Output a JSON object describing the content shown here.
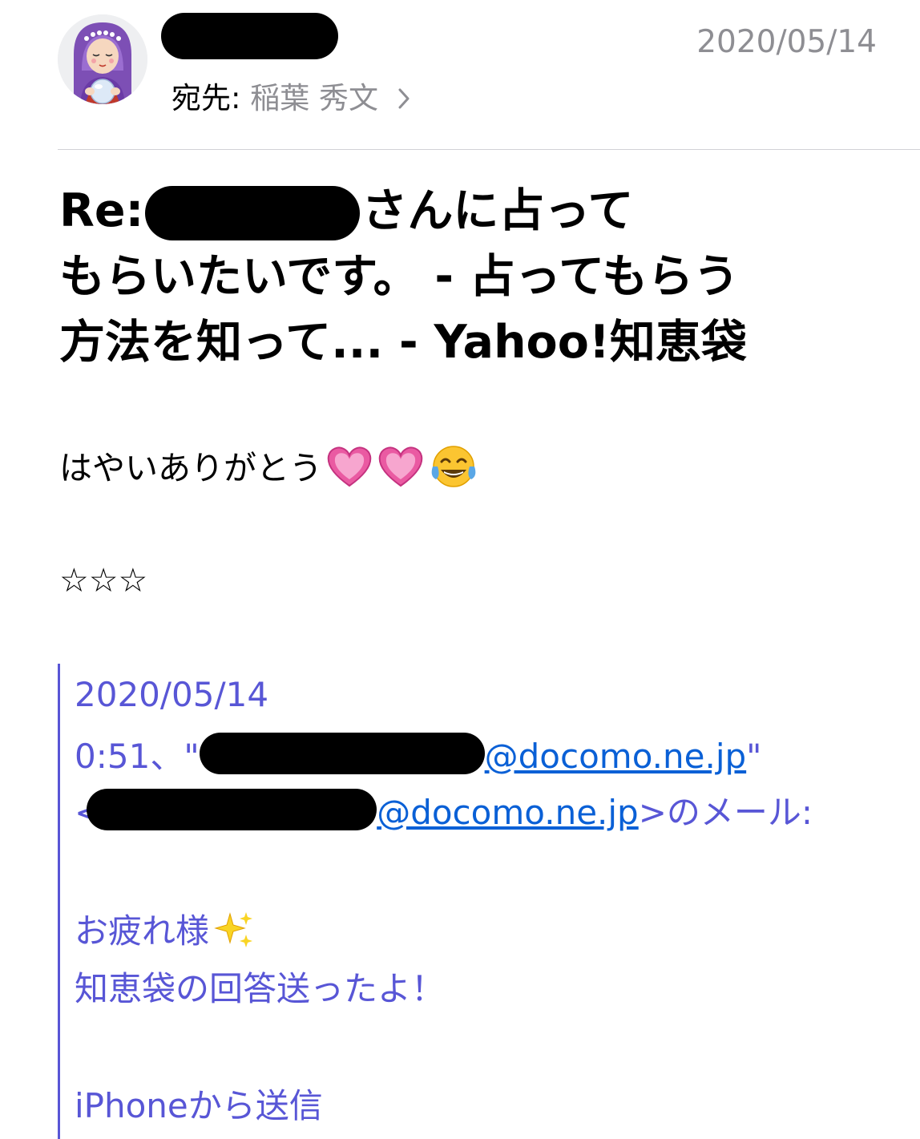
{
  "header": {
    "date": "2020/05/14",
    "to_label": "宛先:",
    "to_name": "稲葉 秀文",
    "sender_name_redacted": true
  },
  "subject": {
    "prefix": "Re:",
    "line1_suffix": "さんに占って",
    "line2": "もらいたいです。 - 占ってもらう",
    "line3": "方法を知って... - Yahoo!知恵袋"
  },
  "body": {
    "thanks_text": "はやいありがとう",
    "emojis": [
      "heart-icon",
      "heart-icon",
      "tears-of-joy-icon"
    ],
    "stars": "☆☆☆"
  },
  "quoted": {
    "date": "2020/05/14",
    "time_prefix": "0:51、\"",
    "email1_domain": "@docomo.ne.jp",
    "email1_close": "\"",
    "email2_open": "<",
    "email2_domain": "@docomo.ne.jp",
    "email2_suffix": ">のメール:",
    "greeting": "お疲れ様",
    "message": "知恵袋の回答送ったよ！",
    "signature": "iPhoneから送信"
  },
  "colors": {
    "accent_quote": "#5856d6",
    "link": "#0a60d6",
    "secondary_text": "#8e8e93",
    "divider": "#d1d1d6"
  }
}
